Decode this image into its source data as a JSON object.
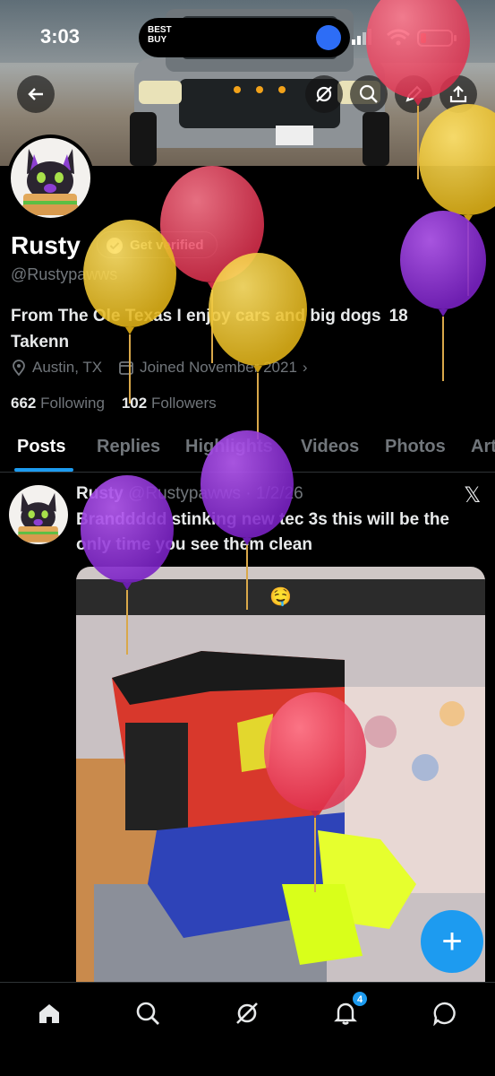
{
  "status_bar": {
    "time": "3:03",
    "island_logo": "BEST BUY"
  },
  "profile": {
    "name": "Rusty",
    "verify_label": "Get verified",
    "handle": "@Rustypawws",
    "bio_line1": "From The Ole Texas I enjoy cars and big dogs  18",
    "bio_line2": "Takenn",
    "location": "Austin, TX",
    "joined": "Joined November 2021",
    "following_count": "662",
    "following_label": "Following",
    "followers_count": "102",
    "followers_label": "Followers"
  },
  "tabs": [
    "Posts",
    "Replies",
    "Highlights",
    "Videos",
    "Photos",
    "Articles"
  ],
  "post": {
    "author": "Rusty",
    "handle_date": "@Rustypawws · 1/2/26",
    "text": "Branddddd stinking new tec 3s this will be the only time you see them clean",
    "media_caption": "🤤"
  },
  "nav": {
    "items": [
      "home-icon",
      "search-icon",
      "grok-icon",
      "notifications-icon",
      "messages-icon"
    ],
    "notification_count": "4"
  },
  "colors": {
    "accent": "#1d9bf0",
    "background": "#000000",
    "muted": "#71767b"
  }
}
